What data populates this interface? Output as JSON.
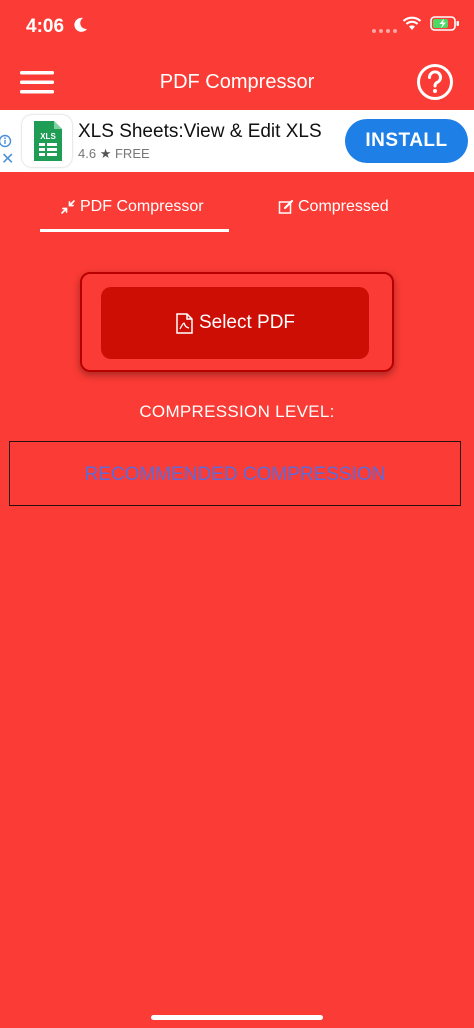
{
  "status_bar": {
    "time": "4:06"
  },
  "app_bar": {
    "title": "PDF Compressor"
  },
  "ad": {
    "title": "XLS Sheets:View & Edit XLS",
    "rating": "4.6",
    "price": "FREE",
    "icon_text": "XLS",
    "install_label": "INSTALL",
    "close_glyph": "✕"
  },
  "tabs": [
    {
      "label": "PDF Compressor",
      "icon": "compress-icon",
      "active": true
    },
    {
      "label": "Compressed",
      "icon": "edit-icon",
      "active": false
    }
  ],
  "main": {
    "select_label": "Select PDF",
    "compression_level_label": "COMPRESSION LEVEL:",
    "compression_value": "RECOMMENDED COMPRESSION"
  },
  "colors": {
    "background": "#fb3b35",
    "select_button": "#cd0e05",
    "install_button": "#1e7fe6",
    "compression_value_text": "#5e6ad6"
  }
}
